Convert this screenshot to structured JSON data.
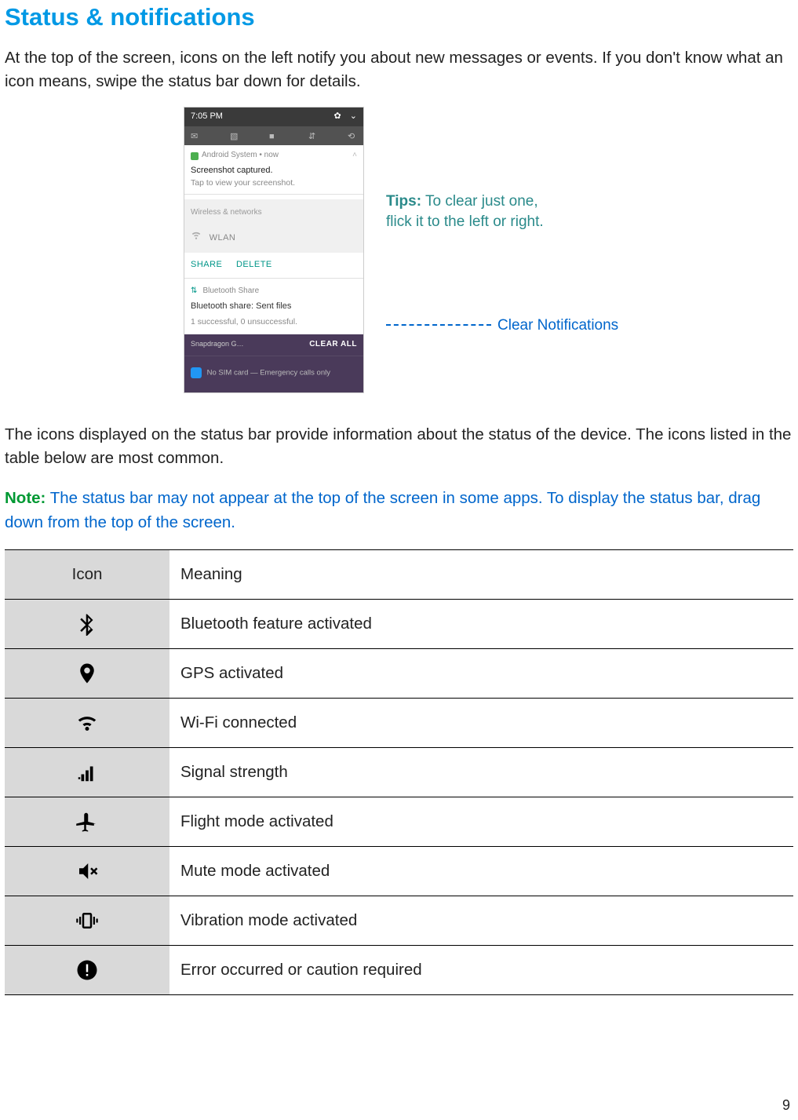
{
  "title": "Status & notifications",
  "intro": "At the top of the screen, icons on the left notify you about new messages or events. If you don't know what an icon means, swipe the status bar down for details.",
  "phone": {
    "time": "7:05 PM",
    "notif_app": "Android System • now",
    "notif_title": "Screenshot captured.",
    "notif_sub": "Tap to view your screenshot.",
    "section_wireless": "Wireless & networks",
    "wlan": "WLAN",
    "action_share": "SHARE",
    "action_delete": "DELETE",
    "bt_share_label": "Bluetooth Share",
    "bt_title": "Bluetooth share: Sent files",
    "bt_sub": "1 successful, 0 unsuccessful.",
    "snap": "Snapdragon G…",
    "clear_all": "CLEAR ALL",
    "no_sim": "No SIM card — Emergency calls only"
  },
  "callouts": {
    "tip_label": "Tips:",
    "tip_text": " To clear just one, flick it to the left or right.",
    "clear_notifications": "Clear Notifications"
  },
  "mid_para": "The icons displayed on the status bar provide information about the status of the device. The icons listed in the table below are most common.",
  "note": {
    "label": "Note:",
    "text": " The status bar may not appear at the top of the screen in some apps. To display the status bar, drag down from the top of the screen."
  },
  "table": {
    "head_icon": "Icon",
    "head_meaning": "Meaning",
    "rows": [
      {
        "icon": "bluetooth",
        "meaning": "Bluetooth feature activated"
      },
      {
        "icon": "gps",
        "meaning": "GPS activated"
      },
      {
        "icon": "wifi",
        "meaning": "Wi-Fi connected"
      },
      {
        "icon": "signal",
        "meaning": "Signal strength"
      },
      {
        "icon": "airplane",
        "meaning": "Flight mode activated"
      },
      {
        "icon": "mute",
        "meaning": "Mute mode activated"
      },
      {
        "icon": "vibrate",
        "meaning": "Vibration mode activated"
      },
      {
        "icon": "error",
        "meaning": "Error occurred or caution required"
      }
    ]
  },
  "page_number": "9"
}
